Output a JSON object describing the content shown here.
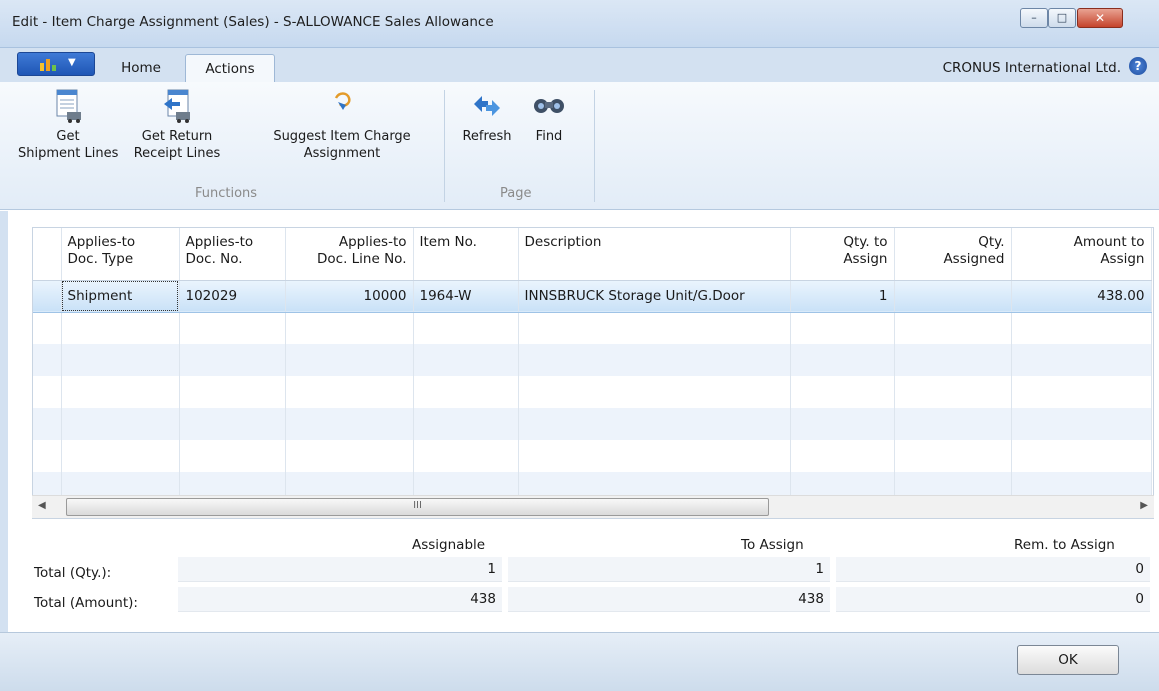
{
  "window": {
    "title": "Edit - Item Charge Assignment (Sales) - S-ALLOWANCE Sales Allowance",
    "minimize_glyph": "–",
    "maximize_glyph": "□",
    "close_glyph": "✕"
  },
  "ribbon_tabs": {
    "home": "Home",
    "actions": "Actions",
    "active": "Actions",
    "company": "CRONUS International Ltd.",
    "help_glyph": "?"
  },
  "ribbon": {
    "functions_group": "Functions",
    "page_group": "Page",
    "get_shipment_lines": {
      "line1": "Get",
      "line2": "Shipment Lines",
      "icon": "document-truck-icon"
    },
    "get_return_receipt_lines": {
      "line1": "Get Return",
      "line2": "Receipt Lines",
      "icon": "document-return-truck-icon"
    },
    "suggest_item_charge": {
      "line1": "Suggest Item Charge",
      "line2": "Assignment",
      "icon": "suggest-icon"
    },
    "refresh": {
      "label": "Refresh",
      "icon": "refresh-icon"
    },
    "find": {
      "label": "Find",
      "icon": "binoculars-icon"
    }
  },
  "grid": {
    "columns": [
      {
        "line1": "Applies-to",
        "line2": "Doc. Type"
      },
      {
        "line1": "Applies-to",
        "line2": "Doc. No."
      },
      {
        "line1": "Applies-to",
        "line2": "Doc. Line No."
      },
      {
        "line1": "Item No.",
        "line2": ""
      },
      {
        "line1": "Description",
        "line2": ""
      },
      {
        "line1": "Qty. to",
        "line2": "Assign"
      },
      {
        "line1": "Qty.",
        "line2": "Assigned"
      },
      {
        "line1": "Amount to",
        "line2": "Assign"
      }
    ],
    "rows": [
      {
        "doc_type": "Shipment",
        "doc_no": "102029",
        "doc_line_no": "10000",
        "item_no": "1964-W",
        "description": "INNSBRUCK Storage Unit/G.Door",
        "qty_to_assign": "1",
        "qty_assigned": "",
        "amount_to_assign": "438.00"
      }
    ],
    "scroll_grip": "III",
    "scroll_left": "◀",
    "scroll_right": "▶"
  },
  "totals": {
    "headers": {
      "assignable": "Assignable",
      "to_assign": "To Assign",
      "rem_to_assign": "Rem. to Assign"
    },
    "qty": {
      "label": "Total (Qty.):",
      "assignable": "1",
      "to_assign": "1",
      "rem_to_assign": "0"
    },
    "amount": {
      "label": "Total (Amount):",
      "assignable": "438",
      "to_assign": "438",
      "rem_to_assign": "0"
    }
  },
  "footer": {
    "ok_label": "OK"
  }
}
